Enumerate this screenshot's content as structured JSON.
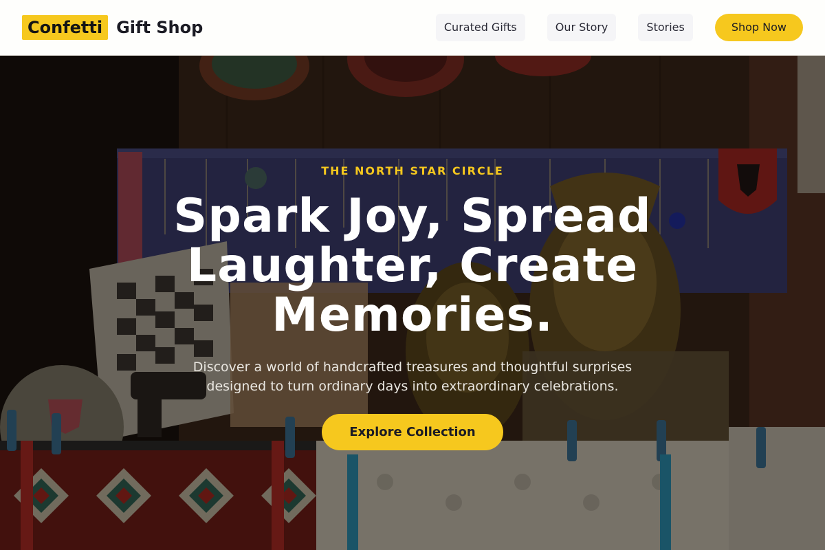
{
  "header": {
    "brand_highlight": "Confetti",
    "brand_rest": "Gift Shop",
    "nav": [
      {
        "label": "Curated Gifts"
      },
      {
        "label": "Our Story"
      },
      {
        "label": "Stories"
      }
    ],
    "cta_label": "Shop Now"
  },
  "hero": {
    "background_image": "gift-shop-display-photo",
    "eyebrow": "THE NORTH STAR CIRCLE",
    "headline": "Spark Joy, Spread Laughter, Create Memories.",
    "subtext": "Discover a world of handcrafted treasures and thoughtful surprises designed to turn ordinary days into extraordinary celebrations.",
    "button_label": "Explore Collection"
  },
  "colors": {
    "accent": "#f6c81e",
    "header_bg": "#fefefc",
    "nav_pill_bg": "#f5f5f7",
    "text_dark": "#1b1b24",
    "hero_text": "#ffffff"
  }
}
